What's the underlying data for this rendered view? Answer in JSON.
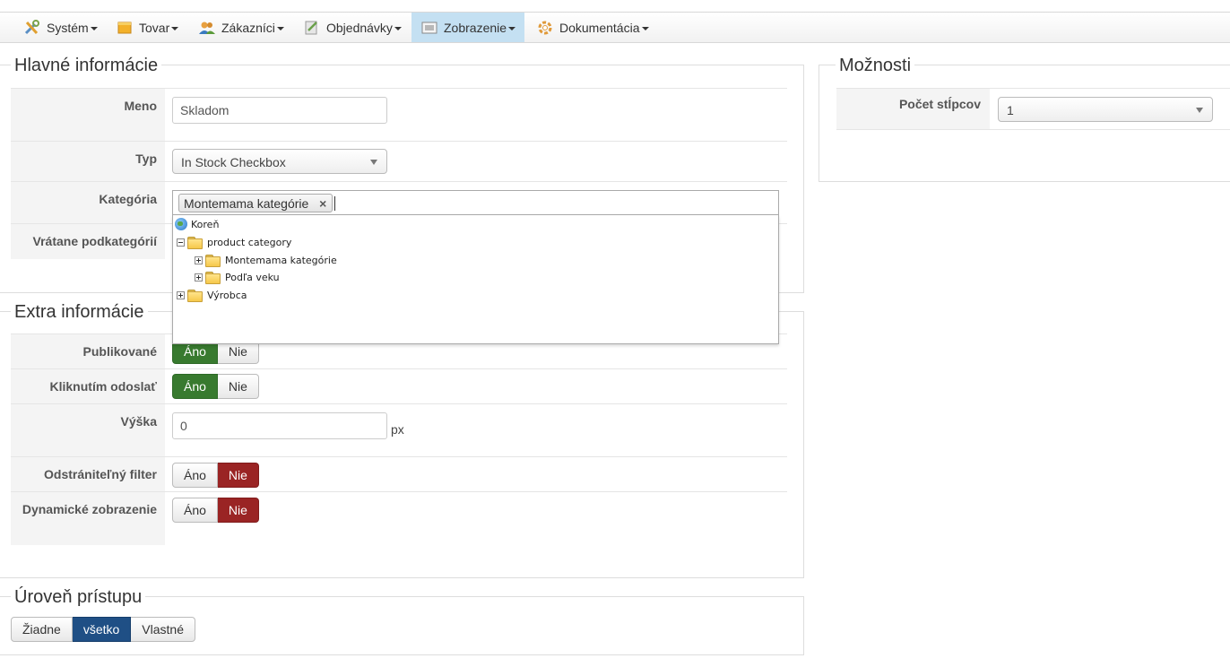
{
  "menu": {
    "items": [
      {
        "label": "Systém",
        "icon": "tools-icon"
      },
      {
        "label": "Tovar",
        "icon": "box-icon"
      },
      {
        "label": "Zákazníci",
        "icon": "users-icon"
      },
      {
        "label": "Objednávky",
        "icon": "orders-icon"
      },
      {
        "label": "Zobrazenie",
        "icon": "display-icon",
        "active": true
      },
      {
        "label": "Dokumentácia",
        "icon": "help-icon"
      }
    ]
  },
  "main_info": {
    "legend": "Hlavné informácie",
    "name_label": "Meno",
    "name_value": "Skladom",
    "type_label": "Typ",
    "type_value": "In Stock Checkbox",
    "category_label": "Kategória",
    "category_tag": "Montemama kategórie",
    "include_sub_label": "Vrátane podkategórií"
  },
  "category_tree": {
    "root": "Koreň",
    "nodes": [
      {
        "label": "product category",
        "expanded": true
      },
      {
        "label": "Montemama kategórie",
        "expanded": false
      },
      {
        "label": "Podľa veku",
        "expanded": false
      },
      {
        "label": "Výrobca",
        "expanded": false
      }
    ]
  },
  "extra_info": {
    "legend": "Extra informácie",
    "published_label": "Publikované",
    "submit_on_click_label": "Kliknutím odoslať",
    "height_label": "Výška",
    "height_value": "0",
    "height_unit": "px",
    "removable_label": "Odstrániteľný filter",
    "dynamic_label": "Dynamické zobrazenie",
    "yes": "Áno",
    "no": "Nie"
  },
  "access": {
    "legend": "Úroveň prístupu",
    "options": [
      "Žiadne",
      "všetko",
      "Vlastné"
    ],
    "selected": "všetko"
  },
  "options": {
    "legend": "Možnosti",
    "columns_label": "Počet stĺpcov",
    "columns_value": "1"
  }
}
